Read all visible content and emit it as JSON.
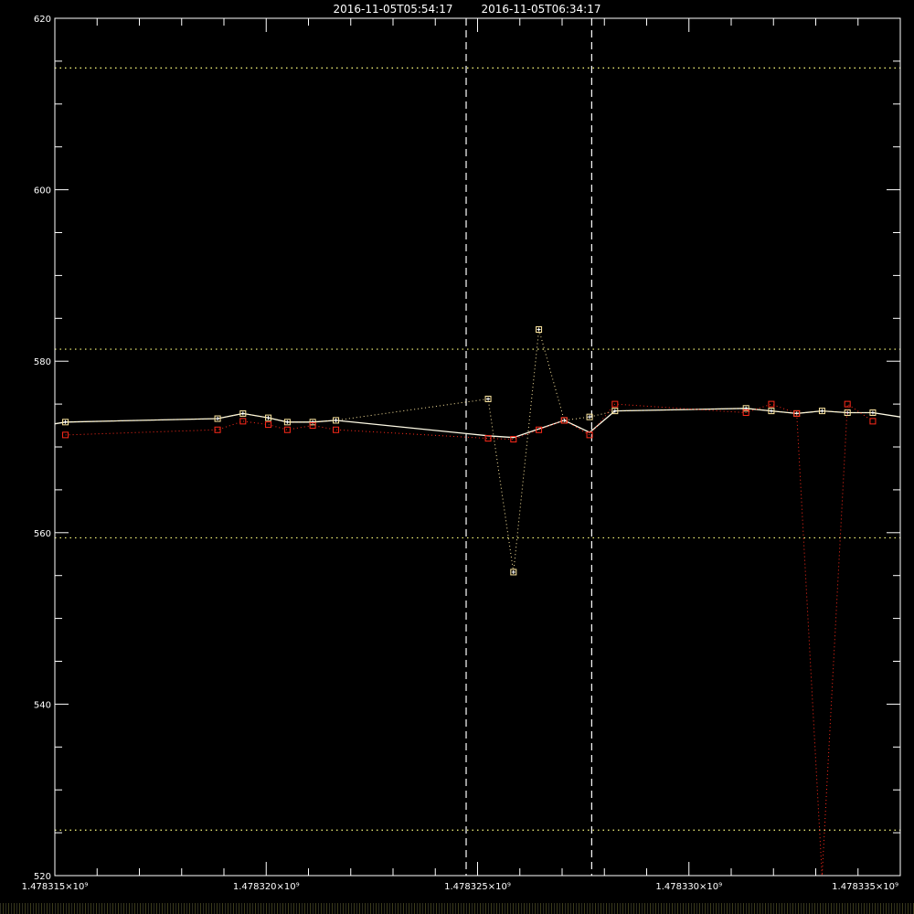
{
  "header": {
    "left_time": "2016-11-05T05:54:17",
    "right_time": "2016-11-05T06:34:17"
  },
  "colors": {
    "background": "#000000",
    "axes": "#ffffff",
    "main_series": "#fffbe6",
    "secondary_series": "#ff2a1a",
    "threshold_lines": "#ffff80",
    "markers": "#ffe8a0"
  },
  "chart_data": {
    "type": "line",
    "title": "",
    "xlabel": "",
    "ylabel": "",
    "xlim": [
      1478315000,
      1478335000
    ],
    "ylim": [
      520,
      620
    ],
    "x_ticks": [
      {
        "value": 1478315000,
        "label": "1.478315×10⁹"
      },
      {
        "value": 1478320000,
        "label": "1.478320×10⁹"
      },
      {
        "value": 1478325000,
        "label": "1.478325×10⁹"
      },
      {
        "value": 1478330000,
        "label": "1.478330×10⁹"
      },
      {
        "value": 1478335000,
        "label": "1.478335×10⁹"
      }
    ],
    "y_ticks": [
      {
        "value": 520,
        "label": "520"
      },
      {
        "value": 540,
        "label": "540"
      },
      {
        "value": 560,
        "label": "560"
      },
      {
        "value": 580,
        "label": "580"
      },
      {
        "value": 600,
        "label": "600"
      },
      {
        "value": 620,
        "label": "620"
      }
    ],
    "vertical_lines": [
      1478324730,
      1478327700
    ],
    "horizontal_dotted_lines": [
      614.2,
      581.4,
      559.4,
      525.3
    ],
    "series": [
      {
        "style": "solid",
        "color": "#fffbe6",
        "x": [
          1478315000,
          1478315250,
          1478318850,
          1478319450,
          1478320050,
          1478320500,
          1478321100,
          1478321650,
          1478325250,
          1478325850,
          1478326450,
          1478327050,
          1478327650,
          1478328250,
          1478331350,
          1478331950,
          1478332550,
          1478333150,
          1478333750,
          1478334350,
          1478335000
        ],
        "y": [
          572.7,
          572.9,
          573.3,
          573.9,
          573.4,
          572.9,
          572.9,
          573.1,
          571.3,
          571.1,
          572.1,
          573.1,
          571.7,
          574.2,
          574.5,
          574.2,
          573.9,
          574.2,
          574.0,
          574.0,
          573.5
        ]
      },
      {
        "style": "dotted",
        "color": "#ffe8a0",
        "x": [
          1478315250,
          1478318850,
          1478319450,
          1478320050,
          1478320500,
          1478321100,
          1478321650,
          1478325250,
          1478325850,
          1478326450,
          1478327050,
          1478327650,
          1478328250,
          1478331350,
          1478331950,
          1478332550,
          1478333150,
          1478333750,
          1478334350
        ],
        "y": [
          572.9,
          573.3,
          573.9,
          573.4,
          572.9,
          572.9,
          573.1,
          575.6,
          555.4,
          583.7,
          573.1,
          573.5,
          574.2,
          574.5,
          574.2,
          573.9,
          574.2,
          574.0,
          574.0
        ]
      },
      {
        "style": "dotted",
        "color": "#ff2a1a",
        "x": [
          1478315250,
          1478318850,
          1478319450,
          1478320050,
          1478320500,
          1478321100,
          1478321650,
          1478325250,
          1478325850,
          1478326450,
          1478327050,
          1478327650,
          1478328250,
          1478331350,
          1478331950,
          1478332550,
          1478333150,
          1478333750,
          1478334350
        ],
        "y": [
          571.4,
          572.0,
          573.0,
          572.6,
          572.0,
          572.5,
          572.0,
          571.0,
          570.9,
          572.0,
          573.1,
          571.4,
          575.0,
          574.0,
          575.0,
          573.9,
          520,
          575.0,
          573.0
        ]
      }
    ]
  }
}
